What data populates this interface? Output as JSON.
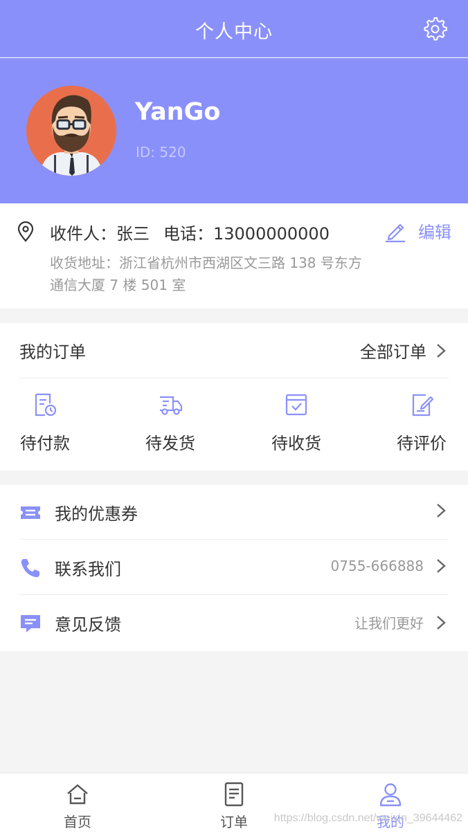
{
  "header": {
    "title": "个人中心",
    "settings_icon": "gear-icon"
  },
  "profile": {
    "username": "YanGo",
    "user_id": "ID: 520"
  },
  "address": {
    "recipient": "收件人：张三",
    "phone": "电话：13000000000",
    "detail": "收货地址：浙江省杭州市西湖区文三路 138 号东方通信大厦 7 楼 501 室",
    "edit_label": "编辑"
  },
  "orders": {
    "title": "我的订单",
    "all_label": "全部订单",
    "items": [
      {
        "label": "待付款",
        "icon": "pending-payment-icon"
      },
      {
        "label": "待发货",
        "icon": "truck-icon"
      },
      {
        "label": "待收货",
        "icon": "package-check-icon"
      },
      {
        "label": "待评价",
        "icon": "review-icon"
      }
    ]
  },
  "menu": [
    {
      "label": "我的优惠券",
      "value": "",
      "icon": "ticket-icon"
    },
    {
      "label": "联系我们",
      "value": "0755-666888",
      "icon": "phone-icon"
    },
    {
      "label": "意见反馈",
      "value": "让我们更好",
      "icon": "chat-icon"
    }
  ],
  "tabbar": [
    {
      "label": "首页",
      "icon": "home-icon"
    },
    {
      "label": "订单",
      "icon": "document-icon"
    },
    {
      "label": "我的",
      "icon": "user-icon",
      "active": true
    }
  ],
  "watermark": "https://blog.csdn.net/weixin_39644462",
  "colors": {
    "accent": "#8a90fa",
    "avatar_bg": "#e96f4c"
  }
}
